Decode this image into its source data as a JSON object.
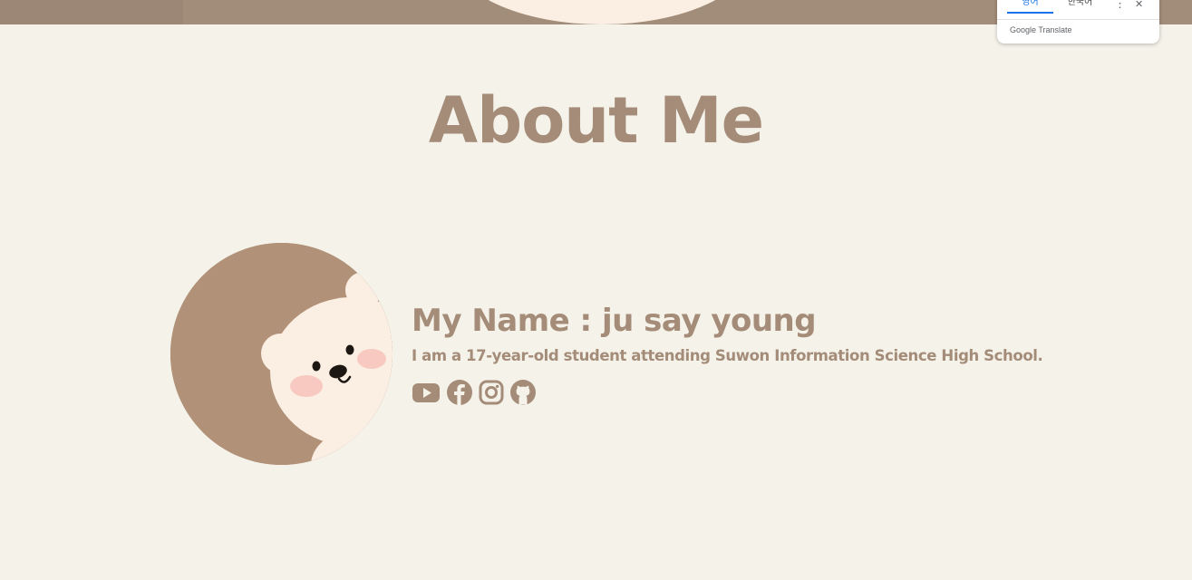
{
  "page": {
    "title": "About Me",
    "name_line": "My Name : ju say young",
    "description": "I am a 17-year-old student attending Suwon Information Science High School."
  },
  "socials": [
    {
      "icon": "youtube-icon"
    },
    {
      "icon": "facebook-icon"
    },
    {
      "icon": "instagram-icon"
    },
    {
      "icon": "github-icon"
    }
  ],
  "translate_popup": {
    "tab_source": "영어",
    "tab_target": "한국어",
    "menu_glyph": "⋮",
    "close_glyph": "✕",
    "brand": "Google Translate"
  },
  "colors": {
    "background": "#f4f2e9",
    "accent": "#a48c79",
    "top_band": "#a28c7a",
    "avatar_bg": "#b19279",
    "bear": "#fbeee2",
    "translate_active": "#1a73e8"
  }
}
